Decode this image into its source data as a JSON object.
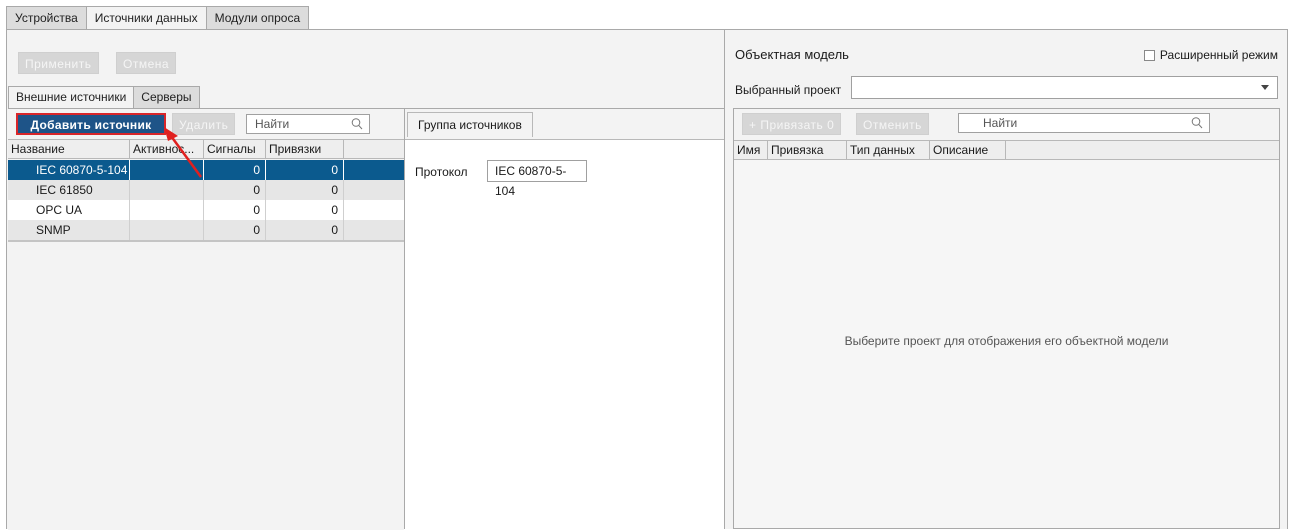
{
  "top_tabs": [
    "Устройства",
    "Источники данных",
    "Модули опроса"
  ],
  "actions": {
    "apply": "Применить",
    "cancel": "Отмена"
  },
  "sub_tabs": [
    "Внешние источники",
    "Серверы"
  ],
  "left_toolbar": {
    "add_source": "Добавить источник",
    "delete": "Удалить",
    "search_placeholder": "Найти"
  },
  "sources_table": {
    "columns": [
      "Название",
      "Активнос...",
      "Сигналы",
      "Привязки"
    ],
    "rows": [
      {
        "name": "IEC 60870-5-104",
        "active": "",
        "signals": "0",
        "bindings": "0"
      },
      {
        "name": "IEC 61850",
        "active": "",
        "signals": "0",
        "bindings": "0"
      },
      {
        "name": "OPC UA",
        "active": "",
        "signals": "0",
        "bindings": "0"
      },
      {
        "name": "SNMP",
        "active": "",
        "signals": "0",
        "bindings": "0"
      }
    ]
  },
  "group": {
    "tab": "Группа источников",
    "protocol_label": "Протокол",
    "protocol_value": "IEC 60870-5-104"
  },
  "object_model": {
    "title": "Объектная модель",
    "advanced_mode": "Расширенный режим",
    "project_label": "Выбранный проект",
    "project_value": "",
    "bind_button": "+ Привязать 0",
    "cancel_button": "Отменить",
    "search_placeholder": "Найти",
    "columns": [
      "Имя",
      "Привязка",
      "Тип данных",
      "Описание"
    ],
    "empty_message": "Выберите проект для отображения его объектной модели"
  },
  "colors": {
    "selected_row": "#0b5a8e",
    "add_button": "#1e5488",
    "highlight": "#d9262a"
  }
}
